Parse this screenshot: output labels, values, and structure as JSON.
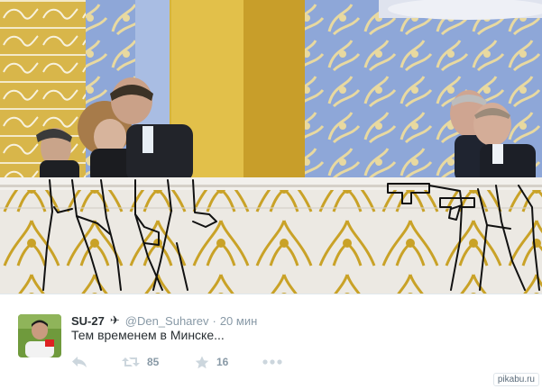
{
  "photo": {
    "description_icon": "photo-image"
  },
  "tweet": {
    "display_name": "SU-27",
    "plane_icon": "airplane-icon",
    "handle": "@Den_Suharev",
    "separator": "·",
    "time": "20 мин",
    "text": "Тем временем в Минске...",
    "actions": {
      "reply_icon": "reply-icon",
      "retweet_icon": "retweet-icon",
      "retweet_count": "85",
      "favorite_icon": "star-icon",
      "favorite_count": "16",
      "more_icon": "more-icon"
    }
  },
  "watermark": {
    "text": "pikabu.ru"
  },
  "colors": {
    "text_dark": "#292f33",
    "text_muted": "#8899a6",
    "icon_muted": "#ccd6dd",
    "gold": "#c9a227",
    "blue_panel": "#8ea7d8",
    "marble": "#e9e6e1"
  }
}
